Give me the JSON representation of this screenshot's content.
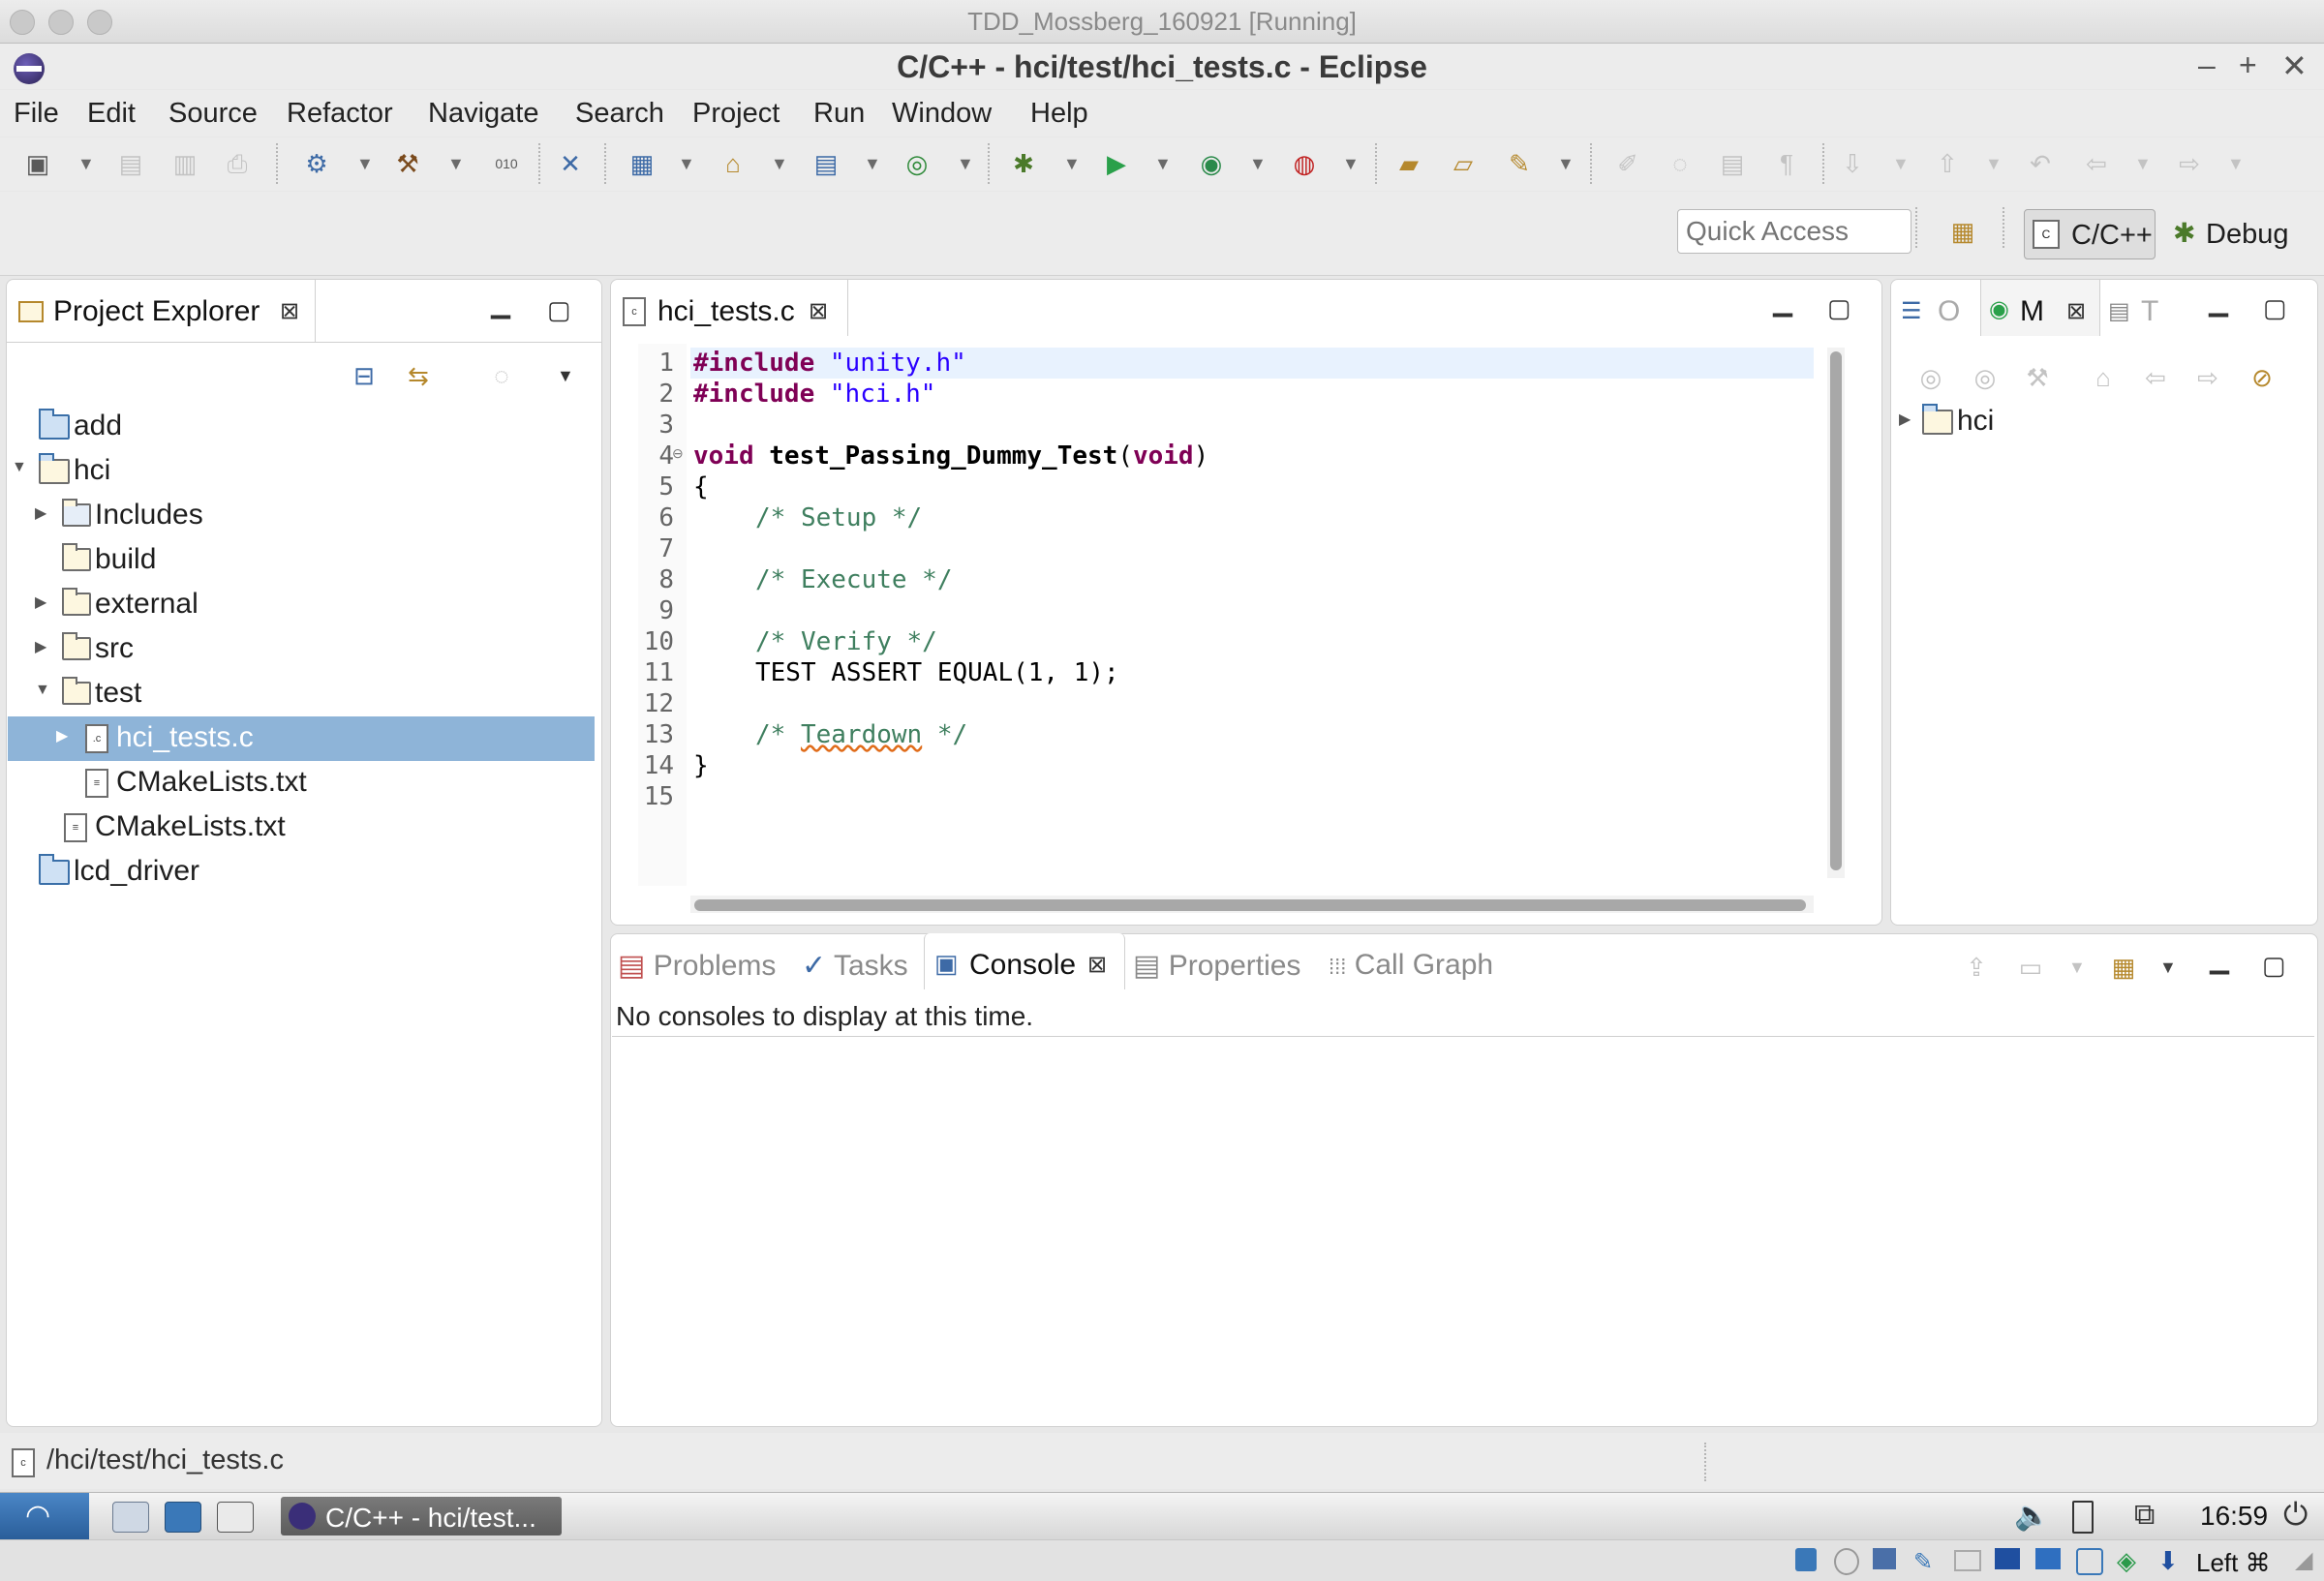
{
  "vm": {
    "title": "TDD_Mossberg_160921 [Running]"
  },
  "window": {
    "title": "C/C++ - hci/test/hci_tests.c - Eclipse",
    "min": "–",
    "max": "+",
    "close": "✕"
  },
  "menu": [
    "File",
    "Edit",
    "Source",
    "Refactor",
    "Navigate",
    "Search",
    "Project",
    "Run",
    "Window",
    "Help"
  ],
  "quick_access": {
    "placeholder": "Quick Access"
  },
  "perspectives": {
    "cpp": "C/C++",
    "debug": "Debug"
  },
  "project_explorer": {
    "title": "Project Explorer",
    "items": [
      {
        "label": "add"
      },
      {
        "label": "hci"
      },
      {
        "label": "Includes"
      },
      {
        "label": "build"
      },
      {
        "label": "external"
      },
      {
        "label": "src"
      },
      {
        "label": "test"
      },
      {
        "label": "hci_tests.c"
      },
      {
        "label": "CMakeLists.txt"
      },
      {
        "label": "CMakeLists.txt"
      },
      {
        "label": "lcd_driver"
      }
    ]
  },
  "editor": {
    "tab": "hci_tests.c",
    "line_numbers": [
      "1",
      "2",
      "3",
      "4",
      "5",
      "6",
      "7",
      "8",
      "9",
      "10",
      "11",
      "12",
      "13",
      "14",
      "15"
    ],
    "lines": {
      "l1_kw": "#include",
      "l1_str": "\"unity.h\"",
      "l2_kw": "#include",
      "l2_str": "\"hci.h\"",
      "l4_kw": "void",
      "l4_fn": "test_Passing_Dummy_Test",
      "l4_paren": "(",
      "l4_kw2": "void",
      "l4_end": ")",
      "l5": "{",
      "l6": "/* Setup */",
      "l8": "/* Execute */",
      "l10": "/* Verify */",
      "l11": "TEST ASSERT EQUAL(1, 1);",
      "l13_a": "/* ",
      "l13_b": "Teardown",
      "l13_c": " */",
      "l14": "}"
    }
  },
  "outline_panel": {
    "tabs": [
      {
        "label": "O"
      },
      {
        "label": "M"
      },
      {
        "label": "T"
      }
    ],
    "tree": [
      {
        "label": "hci"
      }
    ]
  },
  "bottom_panel": {
    "tabs": [
      {
        "label": "Problems"
      },
      {
        "label": "Tasks"
      },
      {
        "label": "Console"
      },
      {
        "label": "Properties"
      },
      {
        "label": "Call Graph"
      }
    ],
    "console_message": "No consoles to display at this time."
  },
  "status_bar": {
    "path": "/hci/test/hci_tests.c"
  },
  "taskbar": {
    "task_label": "C/C++ - hci/test...",
    "clock": "16:59"
  },
  "vm_status": {
    "host_key": "Left ⌘"
  }
}
